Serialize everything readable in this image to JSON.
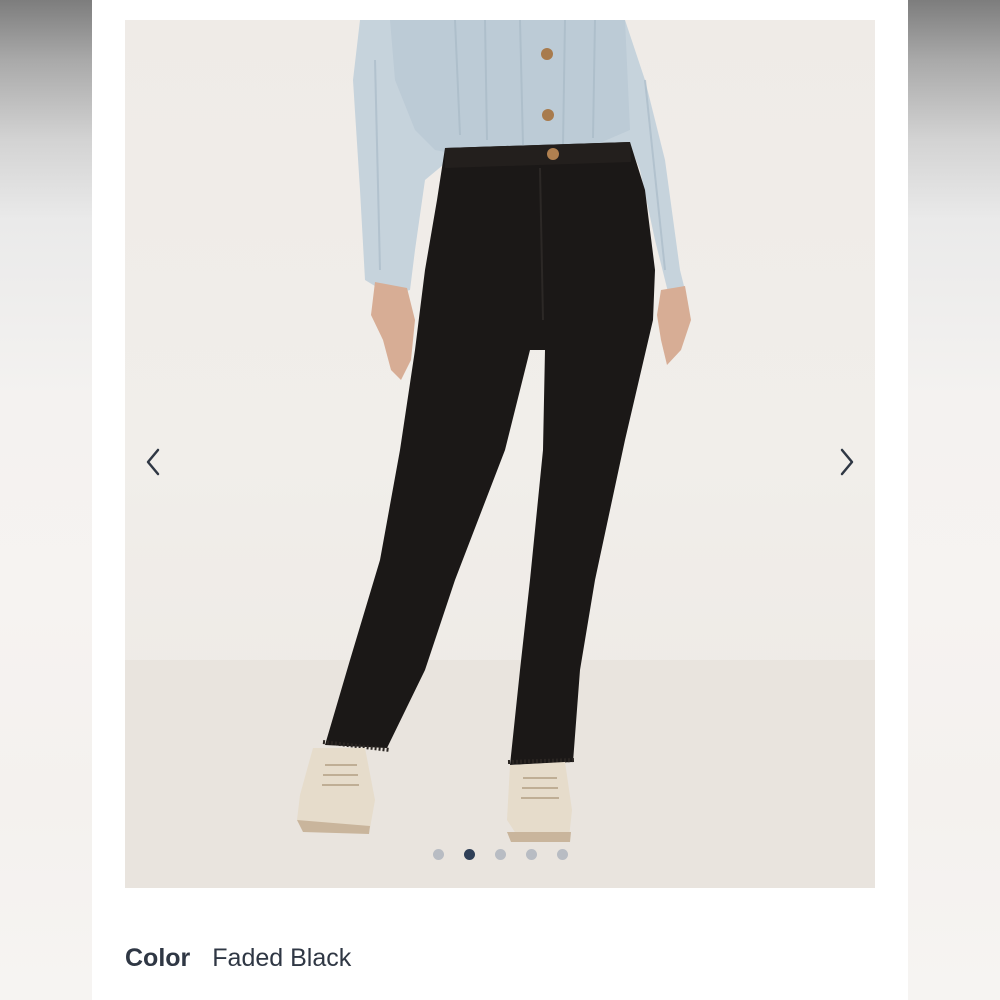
{
  "product_gallery": {
    "image_alt": "Model wearing high-rise wide-leg black jeans with light blue cardigan and cream sneakers",
    "prev_icon": "chevron-left-icon",
    "next_icon": "chevron-right-icon",
    "slide_count": 5,
    "active_slide_index": 1
  },
  "variant": {
    "label": "Color",
    "value": "Faded Black"
  },
  "colors": {
    "dot_inactive": "#b8bcc3",
    "dot_active": "#2f3f57",
    "text": "#2f3744",
    "arrow": "#2f3744"
  }
}
